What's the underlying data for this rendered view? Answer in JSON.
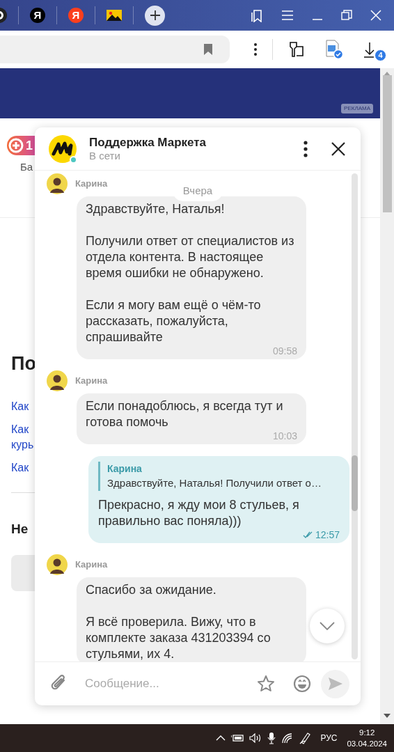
{
  "browser": {
    "tabs": [
      {
        "kind": "partial"
      },
      {
        "kind": "letter",
        "letter": "Я",
        "color": "#000000"
      },
      {
        "kind": "letter",
        "letter": "Я",
        "color": "#fc3f1d"
      },
      {
        "kind": "image"
      }
    ],
    "download_count": "4"
  },
  "page": {
    "ad_label": "РЕКЛАМА",
    "plus_badge": "1",
    "balance_label": "Ба",
    "heading": "По",
    "links": [
      "Как",
      "Как\nкурь",
      "Как"
    ],
    "subheading": "Не"
  },
  "chat": {
    "title": "Поддержка Маркета",
    "status": "В сети",
    "online": true,
    "date_label": "Вчера",
    "messages": [
      {
        "kind": "incoming",
        "author": "Карина",
        "text": "Здравствуйте, Наталья!\n\nПолучили ответ от специалистов из отдела контента. В настоящее время ошибки не обнаружено.\n\nЕсли я могу вам ещё о чём-то рассказать, пожалуйста, спрашивайте",
        "time": "09:58"
      },
      {
        "kind": "incoming",
        "author": "Карина",
        "text": "Если понадоблюсь, я всегда тут и готова помочь",
        "time": "10:03"
      },
      {
        "kind": "outgoing",
        "quote": {
          "author": "Карина",
          "text": "Здравствуйте, Наталья! Получили ответ о…"
        },
        "text": "Прекрасно, я жду мои 8 стульев, я правильно вас поняла)))",
        "time": "12:57",
        "read": true
      },
      {
        "kind": "incoming",
        "author": "Карина",
        "text": "Спасибо за ожидание.\n\nЯ всё проверила. Вижу, что в комплекте заказа 431203394 со стульями, их 4."
      }
    ],
    "input": {
      "placeholder": "Сообщение..."
    }
  },
  "taskbar": {
    "language": "РУС",
    "time": "9:12",
    "date": "03.04.2024"
  }
}
